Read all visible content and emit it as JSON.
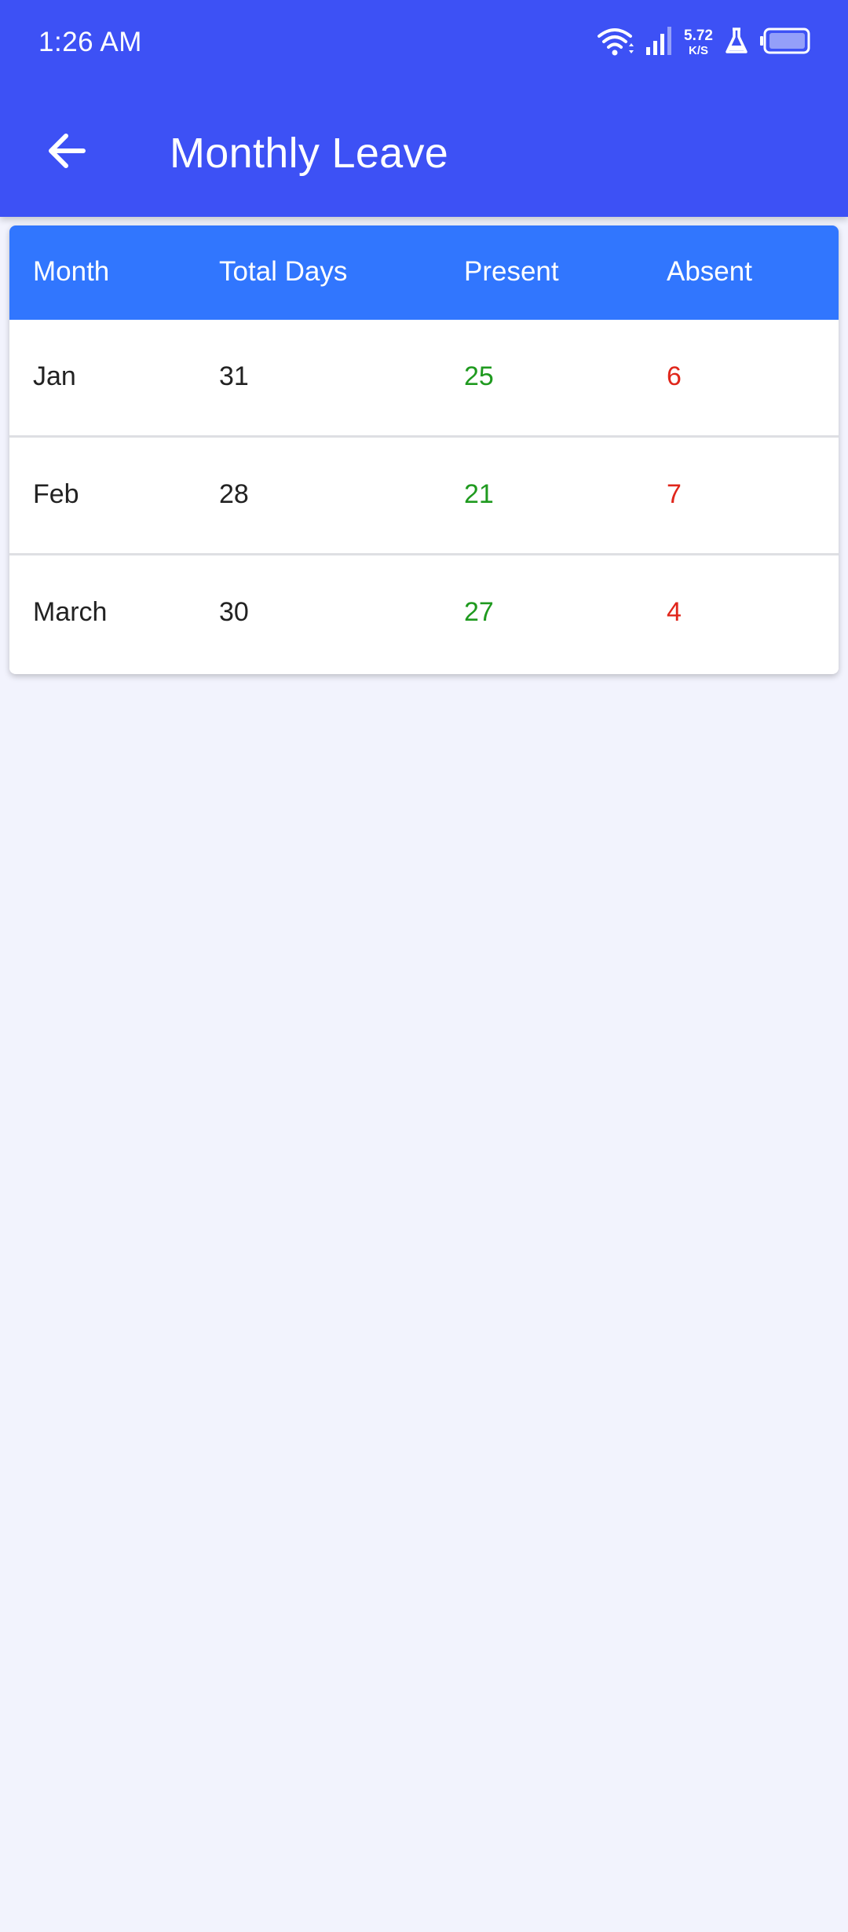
{
  "status_bar": {
    "time": "1:26 AM",
    "net_speed_value": "5.72",
    "net_speed_unit": "K/S",
    "icons": [
      "wifi-icon",
      "signal-icon",
      "lab-icon",
      "battery-icon"
    ]
  },
  "app_bar": {
    "title": "Monthly Leave",
    "back_icon": "arrow-left-icon",
    "color": "#3d51f5"
  },
  "table": {
    "header_color": "#3176fe",
    "present_color": "#1f9a1f",
    "absent_color": "#e0261b",
    "columns": [
      "Month",
      "Total Days",
      "Present",
      "Absent"
    ],
    "rows": [
      {
        "month": "Jan",
        "total": "31",
        "present": "25",
        "absent": "6"
      },
      {
        "month": "Feb",
        "total": "28",
        "present": "21",
        "absent": "7"
      },
      {
        "month": "March",
        "total": "30",
        "present": "27",
        "absent": "4"
      }
    ]
  }
}
